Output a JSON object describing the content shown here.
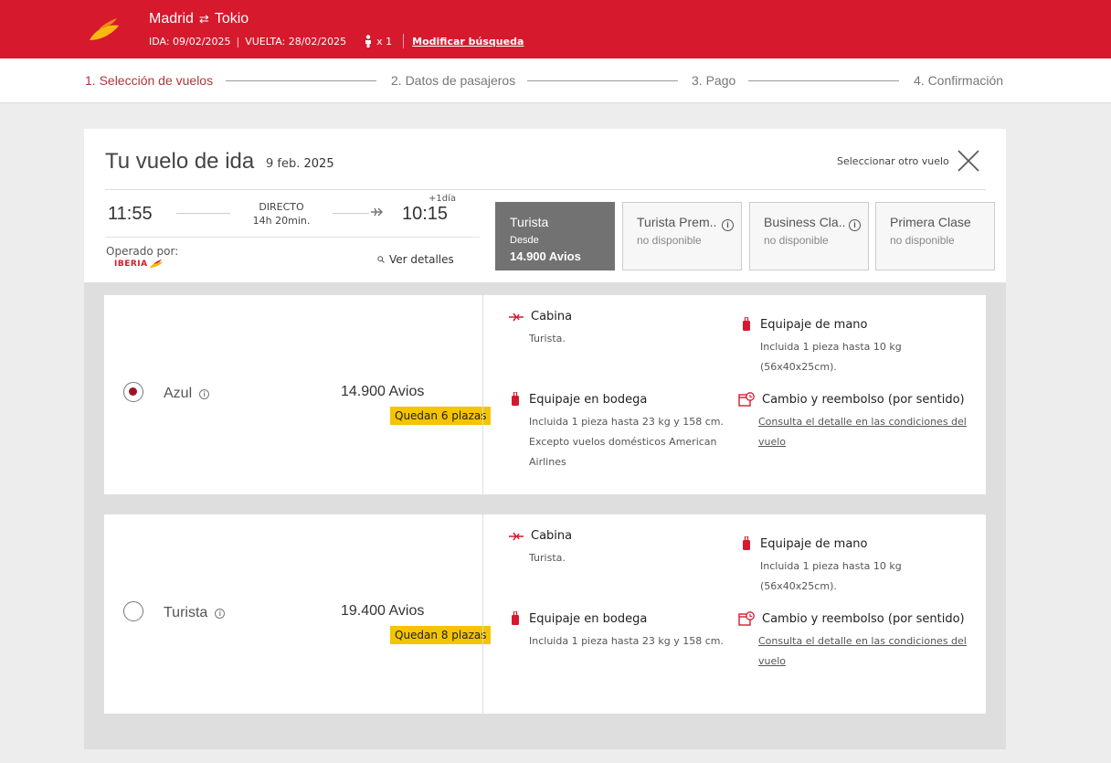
{
  "header": {
    "origin": "Madrid",
    "destination": "Tokio",
    "outbound": "IDA: 09/02/2025",
    "return": "VUELTA: 28/02/2025",
    "passengers": "x 1",
    "modify_label": "Modificar búsqueda",
    "brand_color": "#d7192d"
  },
  "steps": [
    {
      "label": "1. Selección de vuelos",
      "active": true
    },
    {
      "label": "2. Datos de pasajeros",
      "active": false
    },
    {
      "label": "3. Pago",
      "active": false
    },
    {
      "label": "4. Confirmación",
      "active": false
    }
  ],
  "flight": {
    "title": "Tu vuelo de ida",
    "date_day": "9 feb.",
    "date_year": "2025",
    "other_flight_label": "Seleccionar otro vuelo",
    "departure": "11:55",
    "arrival": "10:15",
    "next_day": "+1día",
    "type": "DIRECTO",
    "duration": "14h 20min.",
    "operated_label": "Operado por:",
    "carrier": "IBERIA",
    "details_label": "Ver detalles"
  },
  "fare_tabs": [
    {
      "name": "Turista",
      "sub": "Desde",
      "price": "14.900 Avios",
      "active": true
    },
    {
      "name": "Turista Prem..",
      "sub": "no disponible",
      "active": false
    },
    {
      "name": "Business Cla..",
      "sub": "no disponible",
      "active": false
    },
    {
      "name": "Primera Clase",
      "sub": "no disponible",
      "active": false
    }
  ],
  "options": [
    {
      "name": "Azul",
      "price": "14.900 Avios",
      "seats": "Quedan 6 plazas",
      "selected": true,
      "cabin_title": "Cabina",
      "cabin_text": "Turista.",
      "hand_title": "Equipaje de mano",
      "hand_text1": "Incluida 1 pieza hasta 10 kg",
      "hand_text2": "(56x40x25cm).",
      "hold_title": "Equipaje en bodega",
      "hold_text1": "Incluida 1 pieza hasta 23 kg y 158 cm.",
      "hold_text2": "Excepto vuelos domésticos American",
      "hold_text3": "Airlines",
      "change_title": "Cambio y reembolso (por sentido)",
      "change_link1": "Consulta el detalle en las condiciones del",
      "change_link2": "vuelo"
    },
    {
      "name": "Turista",
      "price": "19.400 Avios",
      "seats": "Quedan 8 plazas",
      "selected": false,
      "cabin_title": "Cabina",
      "cabin_text": "Turista.",
      "hand_title": "Equipaje de mano",
      "hand_text1": "Incluida 1 pieza hasta 10 kg",
      "hand_text2": "(56x40x25cm).",
      "hold_title": "Equipaje en bodega",
      "hold_text1": "Incluida 1 pieza hasta 23 kg y 158 cm.",
      "change_title": "Cambio y reembolso (por sentido)",
      "change_link1": "Consulta el detalle en las condiciones del",
      "change_link2": "vuelo"
    }
  ],
  "icons": [
    "iberia-logo-icon",
    "swap-arrows-icon",
    "passenger-icon",
    "close-icon",
    "plane-icon",
    "search-icon",
    "info-icon",
    "seat-icon",
    "suitcase-icon",
    "calendar-refund-icon"
  ],
  "colors": {
    "accent": "#d7192d",
    "active_step": "#b0353a",
    "selected_tab": "#727272",
    "seats_badge": "#f5c400"
  }
}
